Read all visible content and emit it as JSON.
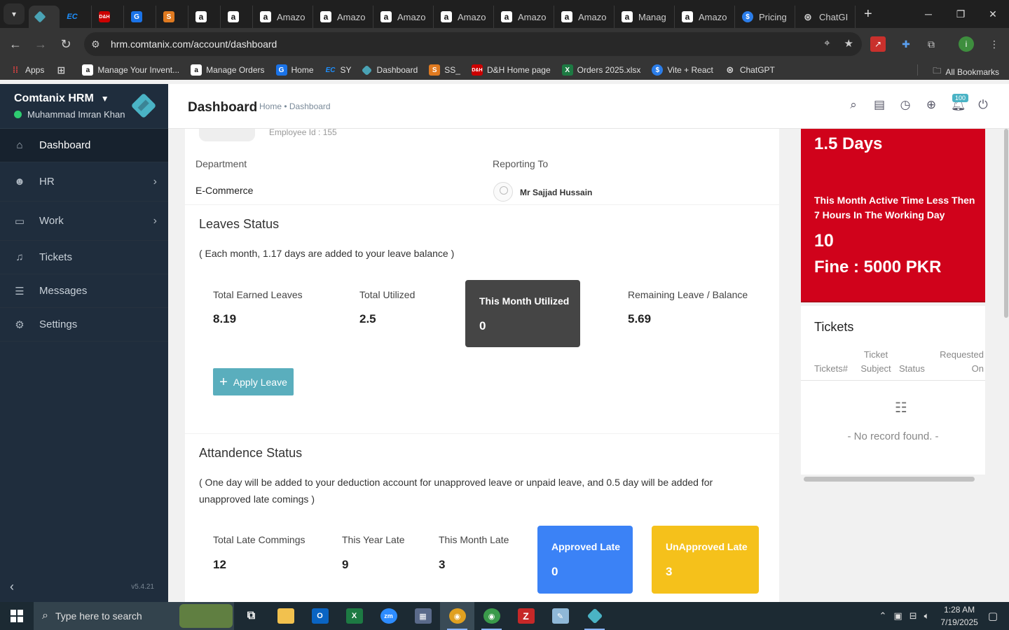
{
  "browser": {
    "tabs": [
      {
        "label": "",
        "icon": "hrm-icon",
        "active": true
      },
      {
        "label": "",
        "icon": "ec-icon"
      },
      {
        "label": "",
        "icon": "dh-icon"
      },
      {
        "label": "",
        "icon": "google-icon"
      },
      {
        "label": "",
        "icon": "ss-icon"
      },
      {
        "label": "",
        "icon": "amazon-icon"
      },
      {
        "label": "",
        "icon": "amazon-icon"
      },
      {
        "label": "Amazo",
        "icon": "amazon-icon"
      },
      {
        "label": "Amazo",
        "icon": "amazon-icon"
      },
      {
        "label": "Amazo",
        "icon": "amazon-icon"
      },
      {
        "label": "Amazo",
        "icon": "amazon-icon"
      },
      {
        "label": "Amazo",
        "icon": "amazon-icon"
      },
      {
        "label": "Amazo",
        "icon": "amazon-icon"
      },
      {
        "label": "Manag",
        "icon": "amazon-icon"
      },
      {
        "label": "Amazo",
        "icon": "amazon-icon"
      },
      {
        "label": "Pricing",
        "icon": "pricing-icon"
      },
      {
        "label": "ChatGI",
        "icon": "chatgpt-icon"
      }
    ],
    "url": "hrm.comtanix.com/account/dashboard",
    "bookmarks": [
      {
        "label": "Apps",
        "icon": "apps-icon"
      },
      {
        "label": "",
        "icon": "grid-icon"
      },
      {
        "label": "Manage Your Invent...",
        "icon": "amazon-icon"
      },
      {
        "label": "Manage Orders",
        "icon": "amazon-icon"
      },
      {
        "label": "Home",
        "icon": "google-icon"
      },
      {
        "label": "SY",
        "icon": "ec-icon"
      },
      {
        "label": "Dashboard",
        "icon": "hrm-icon"
      },
      {
        "label": "SS_",
        "icon": "ss-icon"
      },
      {
        "label": "D&H Home page",
        "icon": "dh-icon"
      },
      {
        "label": "Orders 2025.xlsx",
        "icon": "excel-icon"
      },
      {
        "label": "Vite + React",
        "icon": "vite-icon"
      },
      {
        "label": "ChatGPT",
        "icon": "chatgpt-icon"
      }
    ],
    "all_bookmarks": "All Bookmarks",
    "profile_initial": "i"
  },
  "sidebar": {
    "brand": "Comtanix HRM",
    "user": "Muhammad Imran Khan",
    "items": [
      {
        "label": "Dashboard",
        "icon": "home-icon"
      },
      {
        "label": "HR",
        "icon": "users-icon"
      },
      {
        "label": "Work",
        "icon": "briefcase-icon"
      },
      {
        "label": "Tickets",
        "icon": "headset-icon"
      },
      {
        "label": "Messages",
        "icon": "message-icon"
      },
      {
        "label": "Settings",
        "icon": "gear-icon"
      }
    ],
    "version": "v5.4.21"
  },
  "header": {
    "title": "Dashboard",
    "breadcrumb": "Home • Dashboard",
    "notification_count": "100"
  },
  "profile": {
    "employee_id": "Employee Id : 155",
    "department_label": "Department",
    "department": "E-Commerce",
    "reporting_label": "Reporting To",
    "reporting_to": "Mr Sajjad Hussain"
  },
  "leaves": {
    "title": "Leaves Status",
    "note": "( Each month, 1.17 days are added to your leave balance )",
    "total_earned_label": "Total Earned Leaves",
    "total_earned": "8.19",
    "total_utilized_label": "Total Utilized",
    "total_utilized": "2.5",
    "month_utilized_label": "This Month Utilized",
    "month_utilized": "0",
    "remaining_label": "Remaining Leave / Balance",
    "remaining": "5.69",
    "apply_button": "Apply Leave"
  },
  "attendance": {
    "title": "Attandence Status",
    "note": "( One day will be added to your deduction account for unapproved leave or unpaid leave, and 0.5 day will be added for unapproved late comings )",
    "total_late_label": "Total Late Commings",
    "total_late": "12",
    "year_late_label": "This Year Late",
    "year_late": "9",
    "month_late_label": "This Month Late",
    "month_late": "3",
    "approved_label": "Approved Late",
    "approved": "0",
    "unapproved_label": "UnApproved Late",
    "unapproved": "3"
  },
  "fine": {
    "days": "1.5 Days",
    "message": "This Month Active Time Less Then 7 Hours In The Working Day",
    "count": "10",
    "fine": "Fine : 5000 PKR"
  },
  "tickets": {
    "title": "Tickets",
    "columns": [
      "Tickets#",
      "Ticket Subject",
      "Status",
      "Requested On"
    ],
    "empty": "- No record found. -"
  },
  "taskbar": {
    "search_placeholder": "Type here to search",
    "time": "1:28 AM",
    "date": "7/19/2025"
  },
  "colors": {
    "sidebar": "#1f2d3d",
    "accent": "#4ab3c5",
    "fine_red": "#d0021b",
    "approved_blue": "#3b82f6",
    "unapproved_yellow": "#f5c11b",
    "month_utilized_dark": "#454545"
  }
}
